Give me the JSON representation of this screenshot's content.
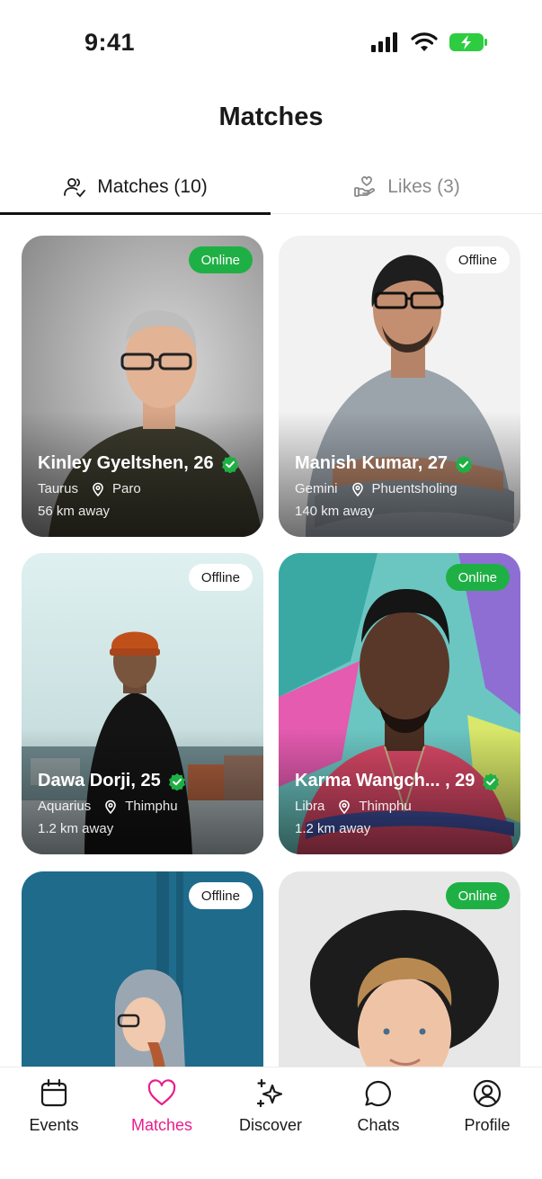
{
  "status": {
    "time": "9:41"
  },
  "header": {
    "title": "Matches"
  },
  "tabs": [
    {
      "label": "Matches (10)",
      "icon": "users-check-icon",
      "active": true
    },
    {
      "label": "Likes (3)",
      "icon": "hand-heart-icon",
      "active": false
    }
  ],
  "cards": [
    {
      "name": "Kinley Gyeltshen, 26",
      "sign": "Taurus",
      "location": "Paro",
      "distance": "56 km away",
      "status": "Online"
    },
    {
      "name": "Manish Kumar, 27",
      "sign": "Gemini",
      "location": "Phuentsholing",
      "distance": "140 km away",
      "status": "Offline"
    },
    {
      "name": "Dawa Dorji, 25",
      "sign": "Aquarius",
      "location": "Thimphu",
      "distance": "1.2 km away",
      "status": "Offline"
    },
    {
      "name": "Karma Wangch... , 29",
      "sign": "Libra",
      "location": "Thimphu",
      "distance": "1.2 km away",
      "status": "Online"
    },
    {
      "status": "Offline"
    },
    {
      "status": "Online"
    }
  ],
  "nav": [
    {
      "label": "Events",
      "icon": "calendar-icon"
    },
    {
      "label": "Matches",
      "icon": "heart-icon",
      "active": true
    },
    {
      "label": "Discover",
      "icon": "sparkles-icon"
    },
    {
      "label": "Chats",
      "icon": "chat-bubble-icon"
    },
    {
      "label": "Profile",
      "icon": "user-circle-icon"
    }
  ],
  "colors": {
    "accent": "#e91e8c",
    "online": "#1fb045",
    "verified": "#1fb045"
  }
}
